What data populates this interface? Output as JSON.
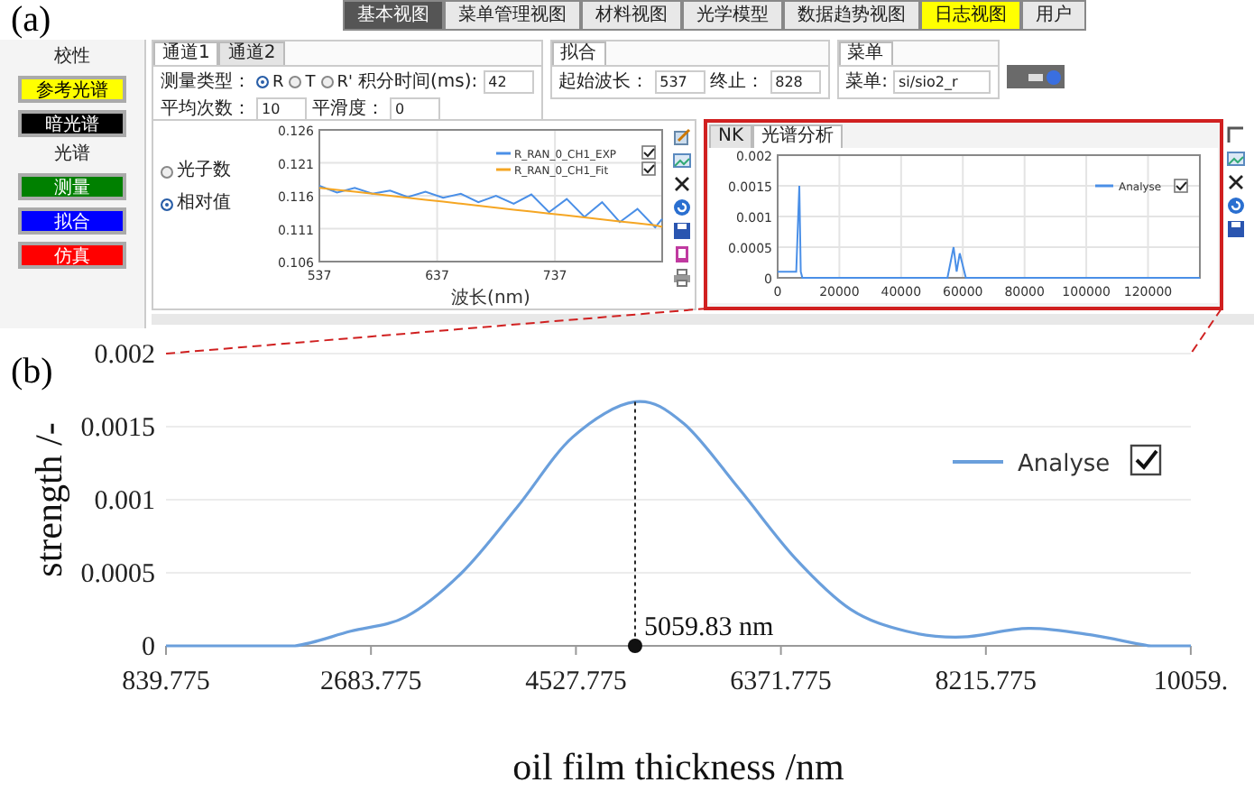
{
  "panel_a": {
    "label": "(a)",
    "nav_tabs": [
      {
        "label": "基本视图",
        "selected": true,
        "highlighted": false
      },
      {
        "label": "菜单管理视图",
        "selected": false,
        "highlighted": false
      },
      {
        "label": "材料视图",
        "selected": false,
        "highlighted": false
      },
      {
        "label": "光学模型",
        "selected": false,
        "highlighted": false
      },
      {
        "label": "数据趋势视图",
        "selected": false,
        "highlighted": false
      },
      {
        "label": "日志视图",
        "selected": false,
        "highlighted": true
      },
      {
        "label": "用户",
        "selected": false,
        "highlighted": false
      }
    ],
    "sidebar": [
      {
        "title": "校性",
        "buttons": [
          {
            "label": "参考光谱",
            "color": "#ffff00"
          },
          {
            "label": "暗光谱",
            "color": "#000000"
          }
        ]
      },
      {
        "title": "光谱",
        "buttons": [
          {
            "label": "测量",
            "color": "#008000"
          },
          {
            "label": "拟合",
            "color": "#0000ff"
          },
          {
            "label": "仿真",
            "color": "#ff0000"
          }
        ]
      }
    ],
    "channel_tabs": [
      {
        "label": "通道1",
        "selected": true
      },
      {
        "label": "通道2",
        "selected": false
      }
    ],
    "measure_type": {
      "label": "测量类型：",
      "modes": [
        {
          "label": "R",
          "selected": true
        },
        {
          "label": "T",
          "selected": false
        },
        {
          "label": "R'",
          "selected": false
        }
      ]
    },
    "measure_fields": [
      {
        "label": "积分时间(ms):",
        "value": "42"
      },
      {
        "label": "平均次数：",
        "value": "10"
      },
      {
        "label": "平滑度：",
        "value": "0"
      }
    ],
    "fit_group": {
      "title": "拟合",
      "fields": [
        {
          "label": "起始波长：",
          "value": "537"
        },
        {
          "label": "终止：",
          "value": "828"
        }
      ]
    },
    "menu_group": {
      "title": "菜单",
      "fields": [
        {
          "label": "菜单:",
          "value": "si/sio2_r"
        }
      ]
    },
    "display_modes": [
      {
        "label": "光子数",
        "selected": false
      },
      {
        "label": "相对值",
        "selected": true
      }
    ],
    "spectrum_chart": {
      "legend_checkboxes": [
        {
          "checked": true
        },
        {
          "checked": true
        }
      ],
      "chart_data": {
        "type": "line",
        "xlabel": "波长(nm)",
        "grid": true,
        "legend": true,
        "x": [
          537,
          552,
          567,
          582,
          597,
          612,
          627,
          642,
          657,
          672,
          687,
          702,
          717,
          732,
          747,
          762,
          777,
          792,
          807,
          822,
          828
        ],
        "series": [
          {
            "name": "R_RAN_0_CH1_EXP",
            "color": "#4a8fe7",
            "values": [
              0.1175,
              0.1165,
              0.1172,
              0.1163,
              0.1168,
              0.1158,
              0.1166,
              0.1157,
              0.1163,
              0.115,
              0.116,
              0.1148,
              0.1162,
              0.1135,
              0.1155,
              0.1128,
              0.115,
              0.112,
              0.114,
              0.1112,
              0.1125
            ]
          },
          {
            "name": "R_RAN_0_CH1_Fit",
            "color": "#f5a623",
            "values": [
              0.1172,
              0.1169,
              0.1166,
              0.1163,
              0.116,
              0.1157,
              0.1154,
              0.1151,
              0.1148,
              0.1145,
              0.1142,
              0.1139,
              0.1136,
              0.1133,
              0.113,
              0.1127,
              0.1124,
              0.1121,
              0.1118,
              0.1115,
              0.1113
            ]
          }
        ],
        "xlim": [
          537,
          828
        ],
        "ylim": [
          0.106,
          0.126
        ],
        "xticks": [
          537,
          637,
          737
        ],
        "yticks": [
          0.106,
          0.111,
          0.116,
          0.121,
          0.126
        ]
      }
    },
    "analysis_tabs": [
      {
        "label": "NK",
        "selected": false
      },
      {
        "label": "光谱分析",
        "selected": true
      }
    ],
    "analysis_chart": {
      "legend_checkboxes": [
        {
          "checked": true
        }
      ],
      "chart_data": {
        "type": "line",
        "grid": true,
        "legend": true,
        "x": [
          0,
          2000,
          4000,
          6000,
          7000,
          7500,
          8000,
          10000,
          20000,
          50000,
          55000,
          57000,
          58000,
          59000,
          61000,
          70000,
          136800
        ],
        "series": [
          {
            "name": "Analyse",
            "color": "#4a8fe7",
            "values": [
              0.0001,
              0.0001,
              0.0001,
              0.0001,
              0.0015,
              0.0001,
              0,
              0,
              0,
              0,
              0,
              0.0005,
              0.0001,
              0.0004,
              0,
              0,
              0
            ]
          }
        ],
        "xlim": [
          0,
          136800
        ],
        "ylim": [
          0,
          0.002
        ],
        "xticks": [
          0,
          20000,
          40000,
          60000,
          80000,
          100000,
          120000
        ],
        "yticks": [
          {
            "value": 0,
            "label": "0"
          },
          {
            "value": 0.0005,
            "label": "0.0005"
          },
          {
            "value": 0.001,
            "label": "0.001"
          },
          {
            "value": 0.0015,
            "label": "0.0015"
          },
          {
            "value": 0.002,
            "label": "0.002"
          }
        ]
      }
    }
  },
  "panel_b": {
    "label": "(b)",
    "legend_checkboxes": [
      {
        "checked": true
      }
    ],
    "chart_data": {
      "type": "line",
      "xlabel": "oil film thickness /nm",
      "ylabel": "strength /-",
      "grid": true,
      "legend": true,
      "x": [
        839.775,
        1500,
        2000,
        2500,
        3000,
        3500,
        4000,
        4500,
        5059.83,
        5500,
        6000,
        6500,
        7000,
        7500,
        8000,
        8600,
        9200,
        9700,
        10059.775
      ],
      "series": [
        {
          "name": "Analyse",
          "color": "#6a9fdc",
          "values": [
            0,
            0,
            0,
            0.0001,
            0.0002,
            0.0005,
            0.00095,
            0.00143,
            0.00167,
            0.00152,
            0.00107,
            0.0006,
            0.00025,
            0.0001,
            6e-05,
            0.00012,
            7e-05,
            0,
            0
          ]
        }
      ],
      "xlim": [
        839.775,
        10059.775
      ],
      "ylim": [
        0,
        0.002
      ],
      "xticks": [
        {
          "value": 839.775,
          "label": "839.775"
        },
        {
          "value": 2683.775,
          "label": "2683.775"
        },
        {
          "value": 4527.775,
          "label": "4527.775"
        },
        {
          "value": 6371.775,
          "label": "6371.775"
        },
        {
          "value": 8215.775,
          "label": "8215.775"
        },
        {
          "value": 10059,
          "label": "10059."
        }
      ],
      "yticks": [
        {
          "value": 0,
          "label": "0"
        },
        {
          "value": 0.0005,
          "label": "0.0005"
        },
        {
          "value": 0.001,
          "label": "0.001"
        },
        {
          "value": 0.0015,
          "label": "0.0015"
        },
        {
          "value": 0.002,
          "label": "0.002"
        }
      ],
      "annotations": [
        {
          "x": 5059.83,
          "y": 0.00167,
          "text": "5059.83 nm"
        }
      ]
    }
  }
}
